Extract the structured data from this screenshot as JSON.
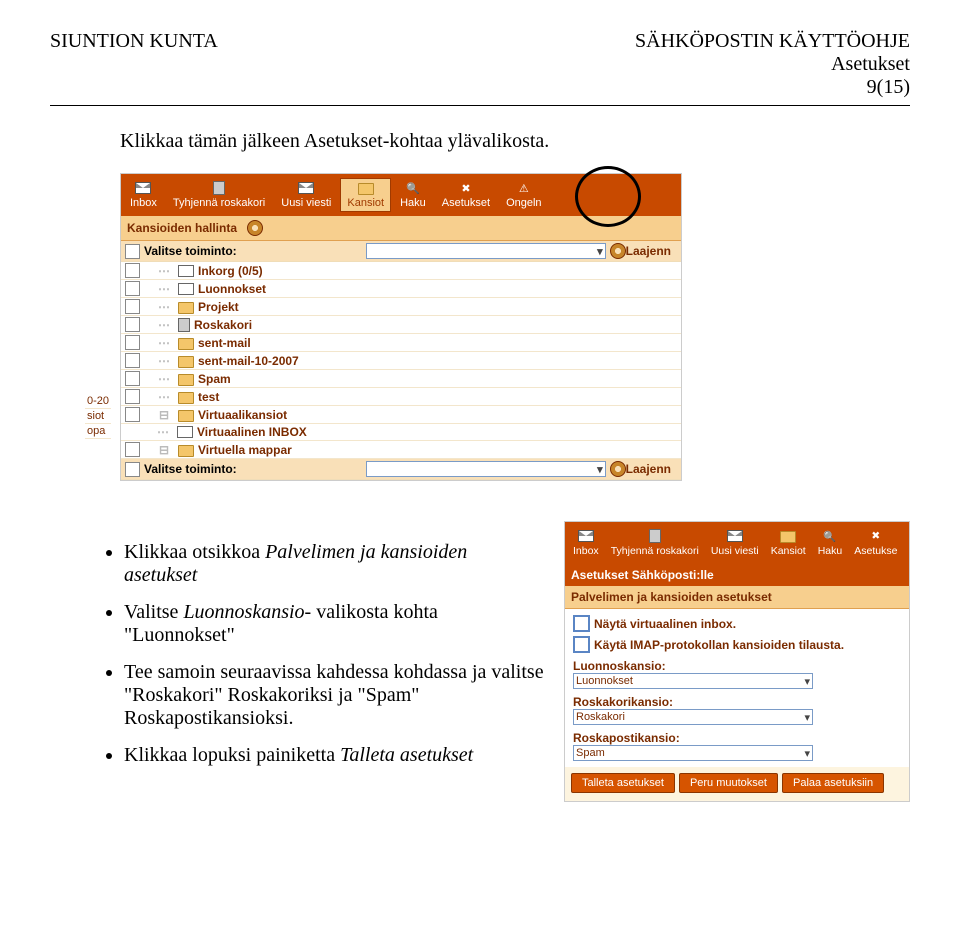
{
  "header": {
    "left": "SIUNTION KUNTA",
    "right_line1": "SÄHKÖPOSTIN KÄYTTÖOHJE",
    "right_line2": "Asetukset",
    "right_line3": "9(15)"
  },
  "intro_text": "Klikkaa tämän jälkeen Asetukset-kohtaa ylävalikosta.",
  "screenshot1": {
    "toolbar": {
      "inbox": "Inbox",
      "empty_trash": "Tyhjennä roskakori",
      "new_msg": "Uusi viesti",
      "folders": "Kansiot",
      "search": "Haku",
      "settings": "Asetukset",
      "problem": "Ongeln"
    },
    "panel_title": "Kansioiden hallinta",
    "action_label": "Valitse toiminto:",
    "expand_label": "Laajenn",
    "folders": [
      {
        "name": "Inkorg (0/5)",
        "icon": "inbox"
      },
      {
        "name": "Luonnokset",
        "icon": "inbox"
      },
      {
        "name": "Projekt",
        "icon": "folder"
      },
      {
        "name": "Roskakori",
        "icon": "trash"
      },
      {
        "name": "sent-mail",
        "icon": "folder"
      },
      {
        "name": "sent-mail-10-2007",
        "icon": "folder"
      },
      {
        "name": "Spam",
        "icon": "folder"
      },
      {
        "name": "test",
        "icon": "folder"
      },
      {
        "name": "Virtuaalikansiot",
        "icon": "folder"
      },
      {
        "name": "Virtuaalinen INBOX",
        "icon": "inbox"
      },
      {
        "name": "Virtuella mappar",
        "icon": "folder"
      }
    ],
    "left_fragments": [
      "0-20",
      "siot",
      "opa"
    ]
  },
  "bullets": {
    "b1_prefix": "Klikkaa otsikkoa ",
    "b1_em": "Palvelimen ja kansioiden asetukset",
    "b2_prefix": "Valitse ",
    "b2_em": "Luonnoskansio-",
    "b2_suffix": " valikosta kohta \"Luonnokset\"",
    "b3": "Tee samoin seuraavissa kahdessa kohdassa ja valitse \"Roskakori\" Roskakoriksi ja \"Spam\" Roskapostikansioksi.",
    "b4_prefix": "Klikkaa lopuksi painiketta ",
    "b4_em": "Talleta asetukset"
  },
  "screenshot2": {
    "toolbar": {
      "inbox": "Inbox",
      "empty_trash": "Tyhjennä roskakori",
      "new_msg": "Uusi viesti",
      "folders": "Kansiot",
      "search": "Haku",
      "settings": "Asetukse"
    },
    "title1": "Asetukset Sähköposti:lle",
    "title2": "Palvelimen ja kansioiden asetukset",
    "cb1": "Näytä virtuaalinen inbox.",
    "cb2": "Käytä IMAP-protokollan kansioiden tilausta.",
    "f1_label": "Luonnoskansio:",
    "f1_value": "Luonnokset",
    "f2_label": "Roskakorikansio:",
    "f2_value": "Roskakori",
    "f3_label": "Roskapostikansio:",
    "f3_value": "Spam",
    "btn_save": "Talleta asetukset",
    "btn_undo": "Peru muutokset",
    "btn_revert": "Palaa asetuksiin"
  }
}
